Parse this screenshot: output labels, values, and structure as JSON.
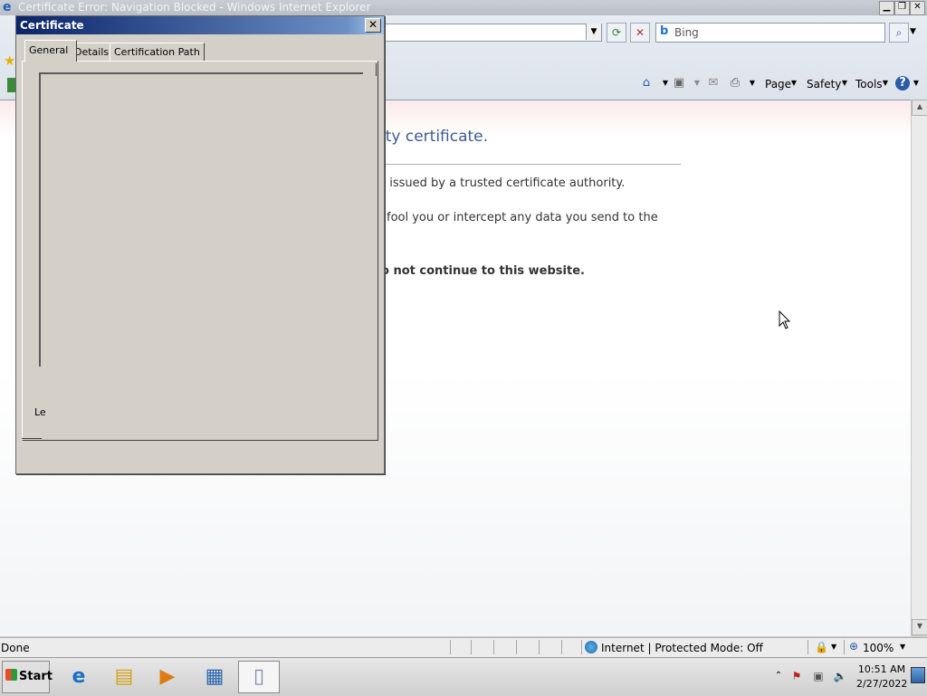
{
  "window": {
    "title": "Certificate Error: Navigation Blocked - Windows Internet Explorer"
  },
  "toolbar": {
    "search_placeholder": "Bing",
    "commands": [
      "Page",
      "Safety",
      "Tools"
    ]
  },
  "page": {
    "heading": "ity certificate.",
    "line1": "t issued by a trusted certificate authority.",
    "line2": "fool you or intercept any data you send to the",
    "line3": "o not continue to this website."
  },
  "dialog": {
    "title": "Certificate",
    "tabs": [
      "General",
      "Details",
      "Certification Path"
    ],
    "active_tab": "General",
    "learn_text": "Le"
  },
  "status": {
    "text": "Done",
    "zone": "Internet | Protected Mode: Off",
    "zoom": "100%"
  },
  "taskbar": {
    "start_label": "Start",
    "time": "10:51 AM",
    "date": "2/27/2022"
  },
  "icons": {
    "ie_logo": "ie-logo-icon",
    "home": "home-icon",
    "feeds": "rss-icon",
    "print": "print-icon",
    "help": "help-icon"
  }
}
